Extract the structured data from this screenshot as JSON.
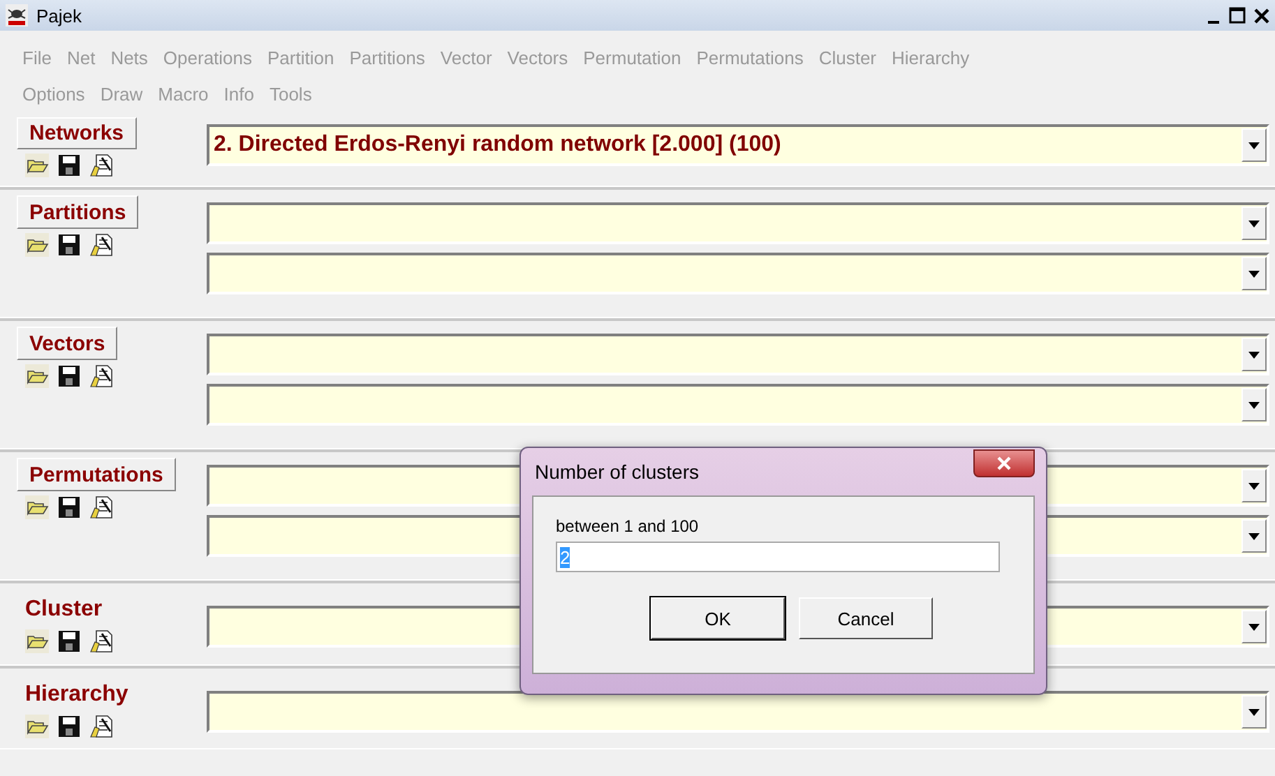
{
  "window": {
    "title": "Pajek"
  },
  "menu": [
    [
      "File",
      "Net",
      "Nets",
      "Operations",
      "Partition",
      "Partitions",
      "Vector",
      "Vectors",
      "Permutation",
      "Permutations",
      "Cluster",
      "Hierarchy"
    ],
    [
      "Options",
      "Draw",
      "Macro",
      "Info",
      "Tools"
    ]
  ],
  "sections": [
    {
      "heading": "Networks",
      "kind": "button",
      "combos": [
        {
          "kind": "dropdown",
          "value": "2. Directed Erdos-Renyi random network [2.000] (100)"
        }
      ]
    },
    {
      "heading": "Partitions",
      "kind": "button",
      "combos": [
        {
          "kind": "dropdown"
        },
        {
          "kind": "dropdown"
        }
      ]
    },
    {
      "heading": "Vectors",
      "kind": "button",
      "combos": [
        {
          "kind": "dropdown"
        },
        {
          "kind": "dropdown"
        }
      ]
    },
    {
      "heading": "Permutations",
      "kind": "button",
      "combos": [
        {
          "kind": "dropdown"
        },
        {
          "kind": "dropdown"
        }
      ]
    },
    {
      "heading": "Cluster",
      "kind": "label",
      "combos": [
        {
          "kind": "dropdown"
        }
      ]
    },
    {
      "heading": "Hierarchy",
      "kind": "label",
      "combos": [
        {
          "kind": "dropdown"
        }
      ]
    }
  ],
  "dialog": {
    "title": "Number of clusters",
    "prompt": "between 1 and 100",
    "value": "2",
    "value_selected": true,
    "buttons": [
      "OK",
      "Cancel"
    ]
  }
}
